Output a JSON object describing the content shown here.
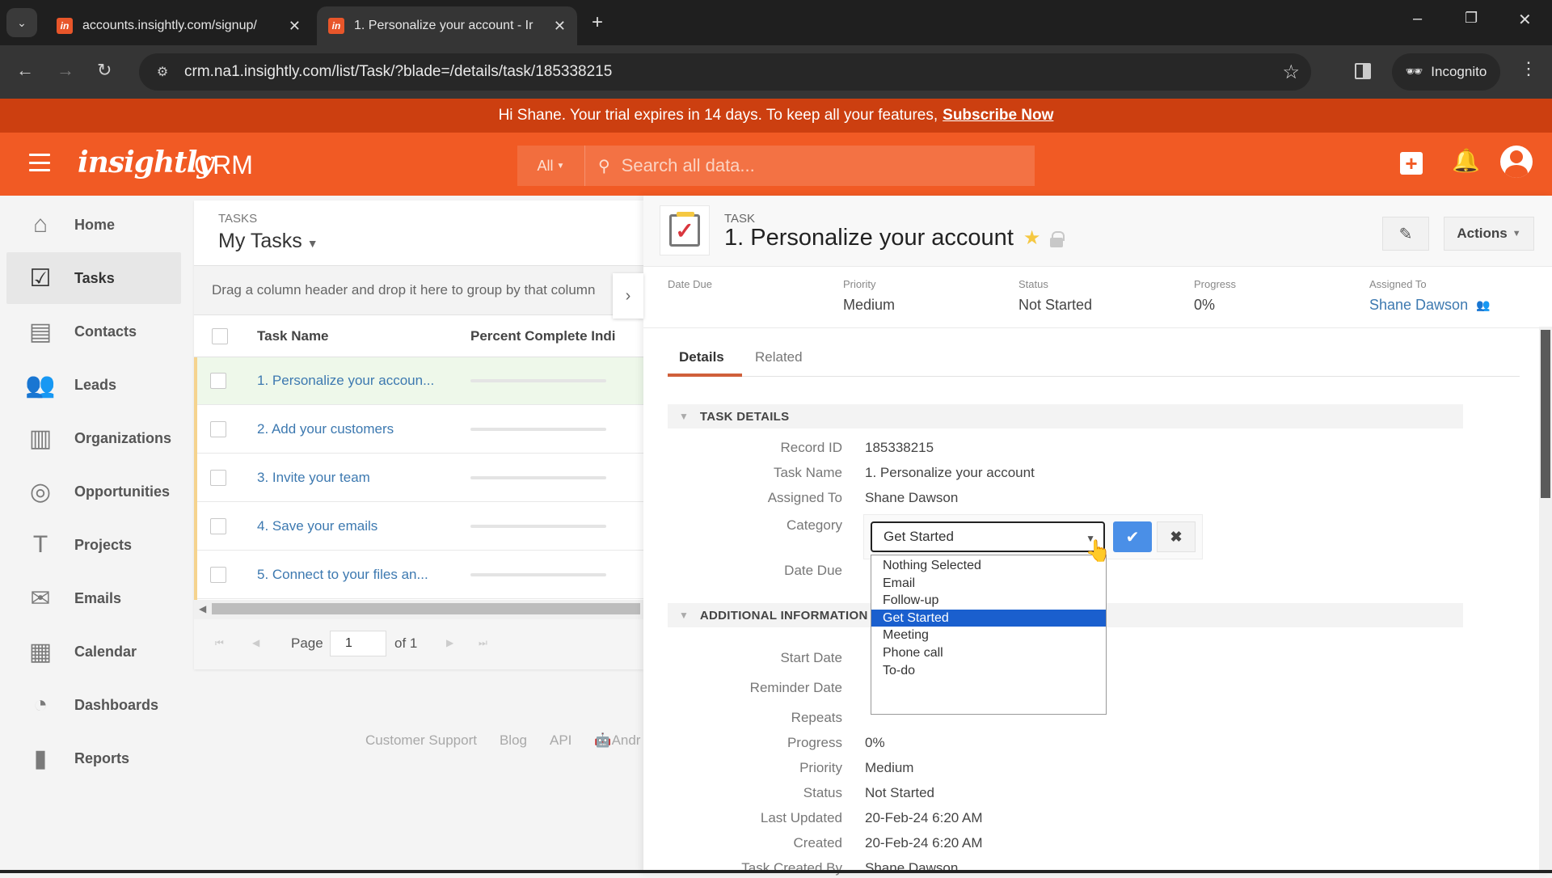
{
  "browser": {
    "tabs": [
      {
        "title": "accounts.insightly.com/signup/",
        "active": false
      },
      {
        "title": "1. Personalize your account - Ir",
        "active": true
      }
    ],
    "url": "crm.na1.insightly.com/list/Task/?blade=/details/task/185338215",
    "incognito_label": "Incognito"
  },
  "banner": {
    "message": "Hi Shane. Your trial expires in 14 days. To keep all your features,",
    "cta": "Subscribe Now"
  },
  "header": {
    "logo": "insightly",
    "product": "CRM",
    "search_scope": "All",
    "search_placeholder": "Search all data..."
  },
  "sidebar": {
    "items": [
      {
        "label": "Home",
        "icon": "home-icon",
        "glyph": "⌂",
        "active": false
      },
      {
        "label": "Tasks",
        "icon": "tasks-icon",
        "glyph": "☑",
        "active": true
      },
      {
        "label": "Contacts",
        "icon": "contacts-icon",
        "glyph": "▤",
        "active": false
      },
      {
        "label": "Leads",
        "icon": "leads-icon",
        "glyph": "👥",
        "active": false
      },
      {
        "label": "Organizations",
        "icon": "organizations-icon",
        "glyph": "▥",
        "active": false
      },
      {
        "label": "Opportunities",
        "icon": "opportunities-icon",
        "glyph": "◎",
        "active": false
      },
      {
        "label": "Projects",
        "icon": "projects-icon",
        "glyph": "T",
        "active": false
      },
      {
        "label": "Emails",
        "icon": "emails-icon",
        "glyph": "✉",
        "active": false
      },
      {
        "label": "Calendar",
        "icon": "calendar-icon",
        "glyph": "▦",
        "active": false
      },
      {
        "label": "Dashboards",
        "icon": "dashboards-icon",
        "glyph": "◔",
        "active": false
      },
      {
        "label": "Reports",
        "icon": "reports-icon",
        "glyph": "▮",
        "active": false
      }
    ]
  },
  "task_list": {
    "eyebrow": "TASKS",
    "title": "My Tasks",
    "group_hint": "Drag a column header and drop it here to group by that column",
    "columns": [
      "Task Name",
      "Percent Complete Indi"
    ],
    "rows": [
      {
        "name": "1. Personalize your accoun...",
        "percent": 0,
        "selected": true
      },
      {
        "name": "2. Add your customers",
        "percent": 0,
        "selected": false
      },
      {
        "name": "3. Invite your team",
        "percent": 0,
        "selected": false
      },
      {
        "name": "4. Save your emails",
        "percent": 0,
        "selected": false
      },
      {
        "name": "5. Connect to your files an...",
        "percent": 0,
        "selected": false
      }
    ],
    "pager": {
      "page_label": "Page",
      "page": "1",
      "of_label": "of 1"
    }
  },
  "footer": {
    "links": [
      "Customer Support",
      "Blog",
      "API",
      "Andr"
    ]
  },
  "detail": {
    "eyebrow": "TASK",
    "title": "1. Personalize your account",
    "actions_label": "Actions",
    "summary": {
      "date_due": {
        "label": "Date Due",
        "value": ""
      },
      "priority": {
        "label": "Priority",
        "value": "Medium"
      },
      "status": {
        "label": "Status",
        "value": "Not Started"
      },
      "progress": {
        "label": "Progress",
        "value": "0%"
      },
      "assigned_to": {
        "label": "Assigned To",
        "value": "Shane Dawson"
      }
    },
    "tabs": [
      "Details",
      "Related"
    ],
    "sections": {
      "task_details": "TASK DETAILS",
      "additional_information": "ADDITIONAL INFORMATION"
    },
    "fields": {
      "record_id": {
        "label": "Record ID",
        "value": "185338215"
      },
      "task_name": {
        "label": "Task Name",
        "value": "1. Personalize your account"
      },
      "assigned_to": {
        "label": "Assigned To",
        "value": "Shane Dawson"
      },
      "category": {
        "label": "Category",
        "value": "Get Started"
      },
      "date_due": {
        "label": "Date Due",
        "value": ""
      },
      "start_date": {
        "label": "Start Date",
        "value": ""
      },
      "reminder_date": {
        "label": "Reminder Date",
        "value": ""
      },
      "repeats": {
        "label": "Repeats",
        "value": ""
      },
      "progress": {
        "label": "Progress",
        "value": "0%"
      },
      "priority": {
        "label": "Priority",
        "value": "Medium"
      },
      "status": {
        "label": "Status",
        "value": "Not Started"
      },
      "last_updated": {
        "label": "Last Updated",
        "value": "20-Feb-24 6:20 AM"
      },
      "created": {
        "label": "Created",
        "value": "20-Feb-24 6:20 AM"
      },
      "task_created_by": {
        "label": "Task Created By",
        "value": "Shane Dawson"
      }
    },
    "category_options": [
      "Nothing Selected",
      "Email",
      "Follow-up",
      "Get Started",
      "Meeting",
      "Phone call",
      "To-do"
    ],
    "category_selected_index": 3
  },
  "colors": {
    "brand": "#f15a24",
    "banner": "#cc3f10",
    "link": "#3d79b0",
    "selected_option": "#1a5fce",
    "confirm": "#4a8fe7"
  }
}
